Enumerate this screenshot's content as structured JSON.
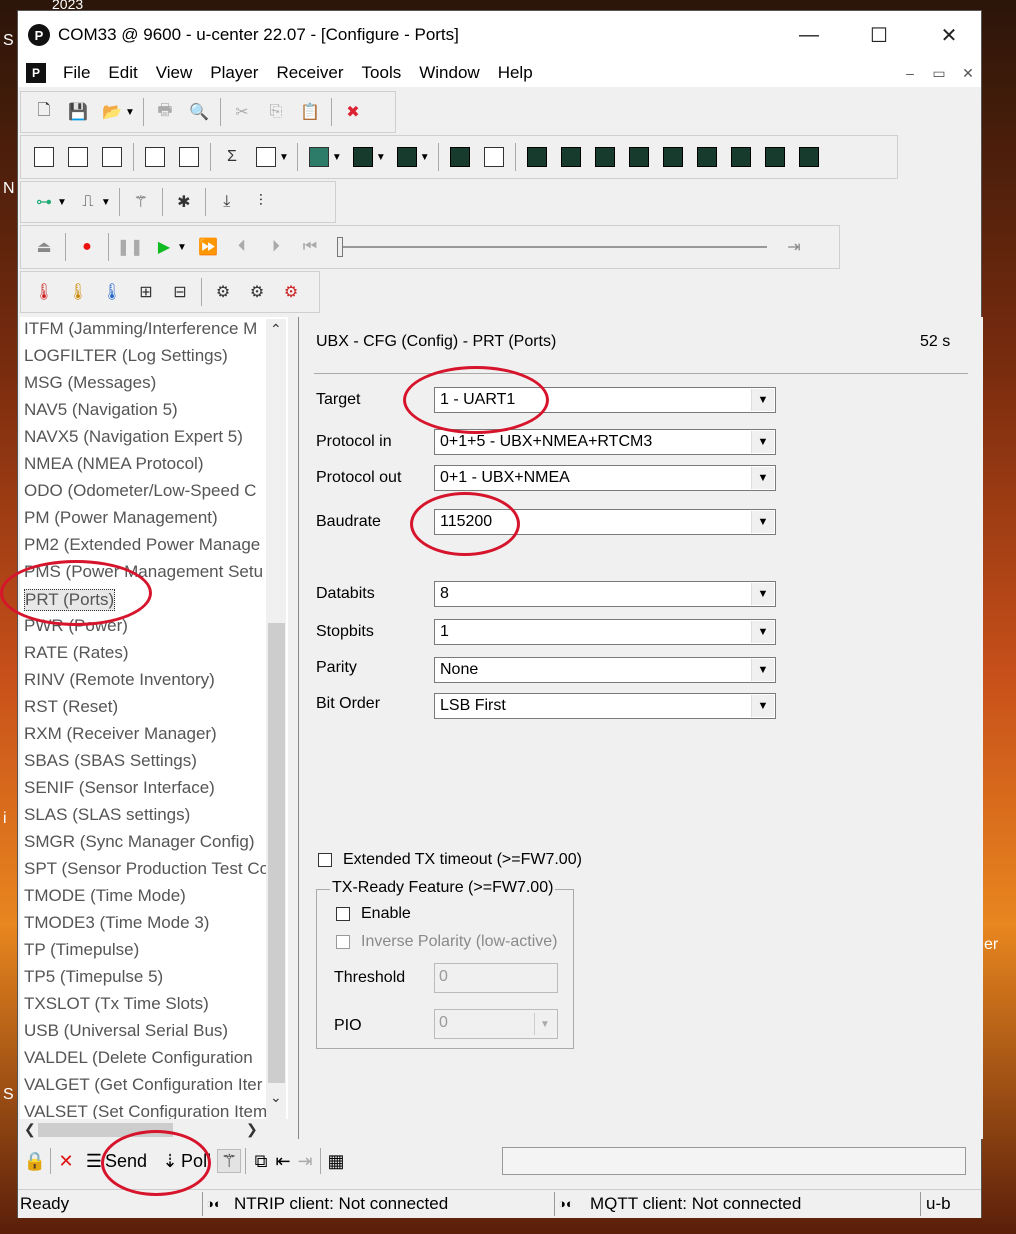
{
  "window": {
    "title": "COM33 @ 9600 - u-center 22.07 - [Configure - Ports]",
    "app_icon_letter": "P",
    "minimize": "—",
    "maximize": "☐",
    "close": "✕"
  },
  "menubar": {
    "logo": "P",
    "items": [
      "File",
      "Edit",
      "View",
      "Player",
      "Receiver",
      "Tools",
      "Window",
      "Help"
    ],
    "mdi_minimize": "–",
    "mdi_restore": "▭",
    "mdi_close": "✕"
  },
  "config_list": {
    "items": [
      "ITFM (Jamming/Interference M",
      "LOGFILTER (Log Settings)",
      "MSG (Messages)",
      "NAV5 (Navigation 5)",
      "NAVX5 (Navigation Expert 5)",
      "NMEA (NMEA Protocol)",
      "ODO (Odometer/Low-Speed C",
      "PM (Power Management)",
      "PM2 (Extended Power Manage",
      "PMS (Power Management Setu",
      "PRT (Ports)",
      "PWR (Power)",
      "RATE (Rates)",
      "RINV (Remote Inventory)",
      "RST (Reset)",
      "RXM (Receiver Manager)",
      "SBAS (SBAS Settings)",
      "SENIF (Sensor Interface)",
      "SLAS (SLAS settings)",
      "SMGR (Sync Manager Config)",
      "SPT (Sensor Production Test Co",
      "TMODE (Time Mode)",
      "TMODE3 (Time Mode 3)",
      "TP (Timepulse)",
      "TP5 (Timepulse 5)",
      "TXSLOT (Tx Time Slots)",
      "USB (Universal Serial Bus)",
      "VALDEL (Delete Configuration",
      "VALGET (Get Configuration Iter",
      "VALSET (Set Configuration Item"
    ],
    "selected": "PRT (Ports)"
  },
  "panel": {
    "header": "UBX - CFG (Config) - PRT (Ports)",
    "age": "52 s",
    "fields": {
      "target": {
        "label": "Target",
        "value": "1 - UART1"
      },
      "protocol_in": {
        "label": "Protocol in",
        "value": "0+1+5 - UBX+NMEA+RTCM3"
      },
      "protocol_out": {
        "label": "Protocol out",
        "value": "0+1 - UBX+NMEA"
      },
      "baudrate": {
        "label": "Baudrate",
        "value": "115200"
      },
      "databits": {
        "label": "Databits",
        "value": "8"
      },
      "stopbits": {
        "label": "Stopbits",
        "value": "1"
      },
      "parity": {
        "label": "Parity",
        "value": "None"
      },
      "bit_order": {
        "label": "Bit Order",
        "value": "LSB First"
      }
    },
    "extended_tx_timeout": "Extended TX timeout (>=FW7.00)",
    "txready": {
      "title": "TX-Ready Feature (>=FW7.00)",
      "enable": "Enable",
      "inverse_polarity": "Inverse Polarity (low-active)",
      "threshold_label": "Threshold",
      "threshold_value": "0",
      "pio_label": "PIO",
      "pio_value": "0"
    }
  },
  "bottombar": {
    "send": "Send",
    "poll": "Poll"
  },
  "status": {
    "ready": "Ready",
    "ntrip": "NTRIP client: Not connected",
    "mqtt": "MQTT client: Not connected",
    "corner": "u-b"
  },
  "desktop_fragments": {
    "year": "2023",
    "s1": "S",
    "n1": "N",
    "i1": "i",
    "s2": "S",
    "er": "er"
  },
  "annotation_color": "#d6152c"
}
